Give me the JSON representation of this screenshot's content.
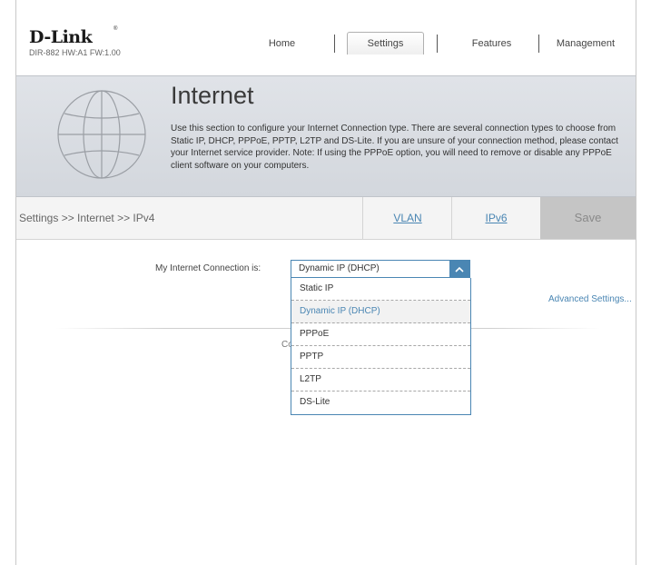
{
  "header": {
    "brand": "D-Link",
    "model_info": "DIR-882 HW:A1 FW:1.00",
    "nav": {
      "home": "Home",
      "settings": "Settings",
      "features": "Features",
      "management": "Management"
    }
  },
  "banner": {
    "title": "Internet",
    "description": "Use this section to configure your Internet Connection type. There are several connection types to choose from Static IP, DHCP, PPPoE, PPTP, L2TP and DS-Lite. If you are unsure of your connection method, please contact your Internet service provider. Note: If using the PPPoE option, you will need to remove or disable any PPPoE client software on your computers.",
    "icon": "globe-icon"
  },
  "subnav": {
    "breadcrumb": "Settings >> Internet >> IPv4",
    "vlan": "VLAN",
    "ipv6": "IPv6",
    "save": "Save"
  },
  "form": {
    "connection_label": "My Internet Connection is:",
    "selected": "Dynamic IP (DHCP)",
    "options": [
      "Static IP",
      "Dynamic IP (DHCP)",
      "PPPoE",
      "PPTP",
      "L2TP",
      "DS-Lite"
    ],
    "advanced": "Advanced Settings...",
    "obscured_text": "Co"
  },
  "colors": {
    "accent": "#4a86b3",
    "save_bg": "#c5c5c5",
    "banner_bg": "#d8dbe0"
  }
}
